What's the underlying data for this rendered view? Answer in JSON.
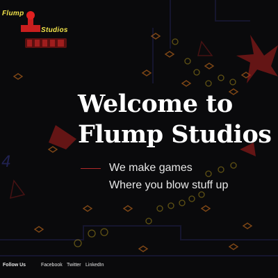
{
  "brand": {
    "line1": "Flump",
    "line2": "Studios"
  },
  "hero": {
    "title_line1": "Welcome to",
    "title_line2": "Flump Studios",
    "tagline1": "We make games",
    "tagline2": "Where you blow stuff up"
  },
  "footer": {
    "follow_label": "Follow Us",
    "links": [
      "Facebook",
      "Twitter",
      "LinkedIn"
    ]
  },
  "colors": {
    "background": "#0a0a0c",
    "accent": "#b22a2a",
    "logo_text": "#f2e34a",
    "decor_orange": "#e07a1f",
    "decor_red": "#a01d1d",
    "decor_yellow": "#b59a1c",
    "decor_blue": "#2a2c6e"
  }
}
